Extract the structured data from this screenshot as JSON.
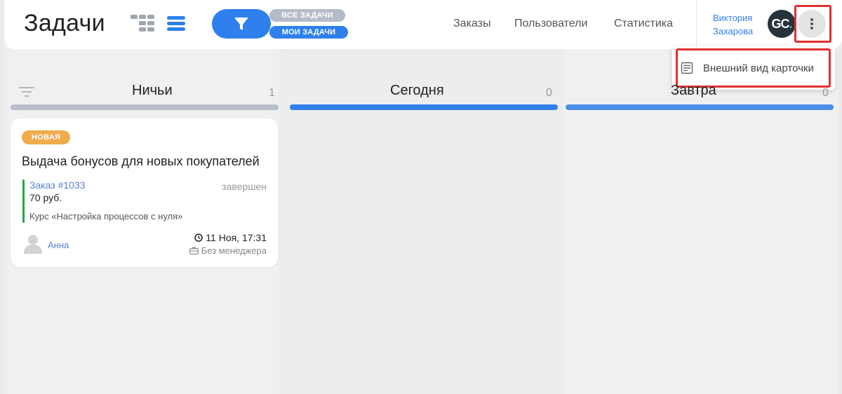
{
  "header": {
    "title": "Задачи",
    "filters": {
      "all_label": "ВСЕ ЗАДАЧИ",
      "my_label": "МОИ ЗАДАЧИ"
    },
    "nav": [
      {
        "label": "Заказы"
      },
      {
        "label": "Пользователи"
      },
      {
        "label": "Статистика"
      }
    ],
    "user": {
      "first_name": "Виктория",
      "last_name": "Захарова",
      "avatar_initials": "GC",
      "avatar_dot": "."
    }
  },
  "dropdown": {
    "items": [
      {
        "label": "Внешний вид карточки",
        "icon": "card-view-icon"
      }
    ]
  },
  "columns": [
    {
      "title": "Ничьи",
      "count": "1",
      "bar_color": "#b9c0cb"
    },
    {
      "title": "Сегодня",
      "count": "0",
      "bar_color": "#2f80ed"
    },
    {
      "title": "Завтра",
      "count": "0",
      "bar_color": "#4a90e8"
    }
  ],
  "card": {
    "badge": "НОВАЯ",
    "title": "Выдача бонусов для новых покупателей",
    "order_link": "Заказ #1033",
    "order_status": "завершен",
    "order_price": "70 руб.",
    "course": "Курс «Настройка процессов с нуля»",
    "assignee": "Анна",
    "due": "11 Ноя, 17:31",
    "manager": "Без менеджера"
  },
  "colors": {
    "accent": "#2f80ed",
    "badge_new": "#f0ab4c",
    "order_bar": "#27a745",
    "highlight": "#e03131"
  }
}
